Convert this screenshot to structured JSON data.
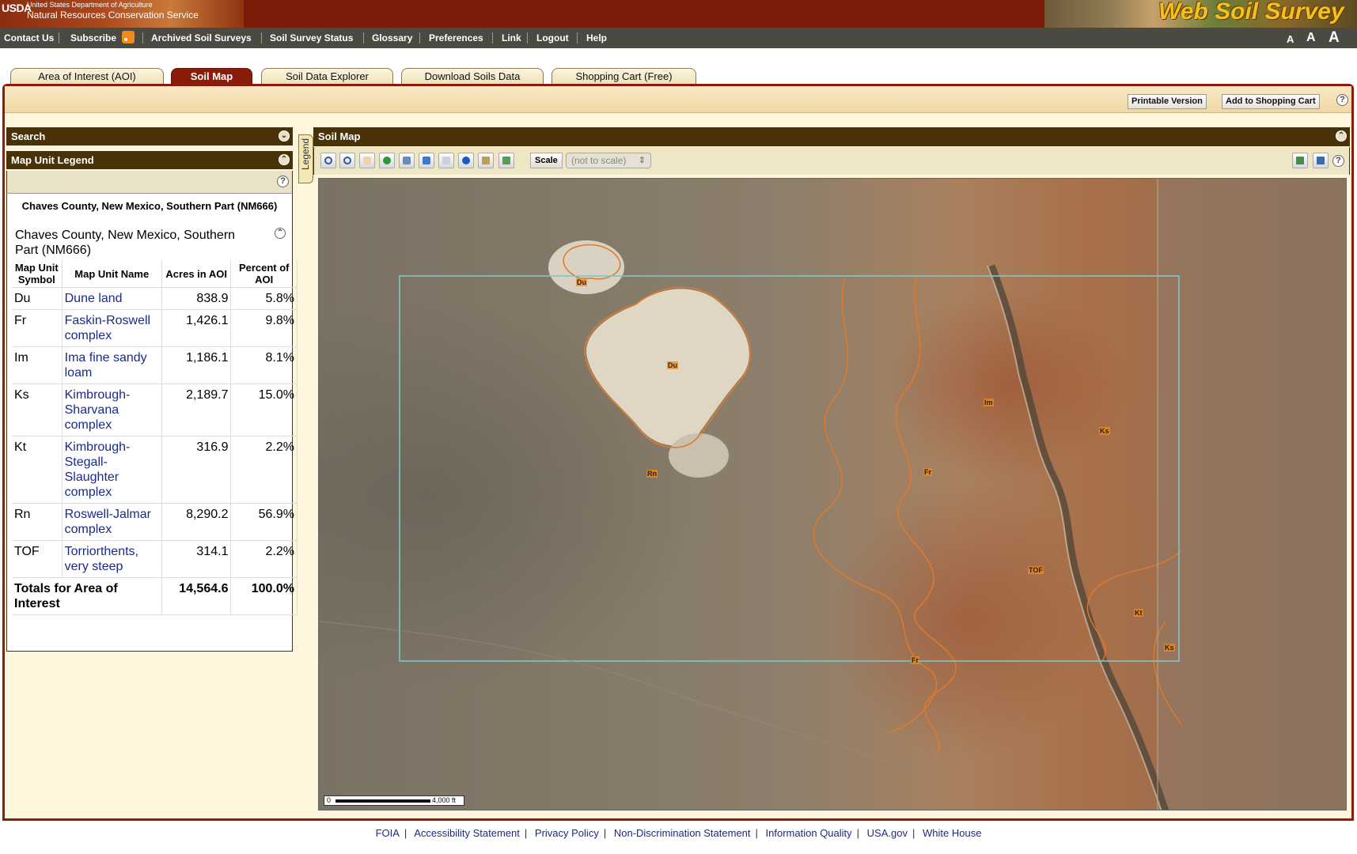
{
  "header": {
    "usda_mark": "USDA",
    "agency_line1": "United States Department of Agriculture",
    "agency_line2": "Natural Resources Conservation Service",
    "app_title": "Web Soil Survey"
  },
  "topnav": {
    "items": [
      "Contact Us",
      "Subscribe",
      "Archived Soil Surveys",
      "Soil Survey Status",
      "Glossary",
      "Preferences",
      "Link",
      "Logout",
      "Help"
    ],
    "font_sizes": [
      "A",
      "A",
      "A"
    ]
  },
  "tabs": [
    "Area of Interest (AOI)",
    "Soil Map",
    "Soil Data Explorer",
    "Download Soils Data",
    "Shopping Cart (Free)"
  ],
  "active_tab": "Soil Map",
  "actions": {
    "printable": "Printable Version",
    "add_cart": "Add to Shopping Cart",
    "help": "?"
  },
  "left_panel": {
    "search_title": "Search",
    "legend_title": "Map Unit Legend",
    "survey_heading": "Chaves County, New Mexico, Southern Part (NM666)",
    "survey_name": "Chaves County, New Mexico, Southern Part (NM666)",
    "columns": [
      "Map Unit Symbol",
      "Map Unit Name",
      "Acres in AOI",
      "Percent of AOI"
    ],
    "rows": [
      {
        "symbol": "Du",
        "name": "Dune land",
        "acres": "838.9",
        "percent": "5.8%"
      },
      {
        "symbol": "Fr",
        "name": "Faskin-Roswell complex",
        "acres": "1,426.1",
        "percent": "9.8%"
      },
      {
        "symbol": "Im",
        "name": "Ima fine sandy loam",
        "acres": "1,186.1",
        "percent": "8.1%"
      },
      {
        "symbol": "Ks",
        "name": "Kimbrough-Sharvana complex",
        "acres": "2,189.7",
        "percent": "15.0%"
      },
      {
        "symbol": "Kt",
        "name": "Kimbrough-Stegall-Slaughter complex",
        "acres": "316.9",
        "percent": "2.2%"
      },
      {
        "symbol": "Rn",
        "name": "Roswell-Jalmar complex",
        "acres": "8,290.2",
        "percent": "56.9%"
      },
      {
        "symbol": "TOF",
        "name": "Torriorthents, very steep",
        "acres": "314.1",
        "percent": "2.2%"
      }
    ],
    "total": {
      "label": "Totals for Area of Interest",
      "acres": "14,564.6",
      "percent": "100.0%"
    }
  },
  "legend_tab": "Legend",
  "map_panel": {
    "title": "Soil Map",
    "scale_label": "Scale",
    "scale_value": "(not to scale)",
    "tools": [
      "zoom-in",
      "zoom-out",
      "pan",
      "zoom-to-full",
      "zoom-to-aoi",
      "previous-view",
      "next-view",
      "identify",
      "measure",
      "clear"
    ],
    "map_labels": [
      "Du",
      "Du",
      "Rn",
      "Im",
      "Fr",
      "Ks",
      "TOF",
      "Kt",
      "Ks",
      "Fr"
    ],
    "scale_bar": {
      "start": "0",
      "end": "4,000 ft"
    }
  },
  "footer": [
    "FOIA",
    "Accessibility Statement",
    "Privacy Policy",
    "Non-Discrimination Statement",
    "Information Quality",
    "USA.gov",
    "White House"
  ],
  "colors": {
    "brand_dark_red": "#8a1c0a",
    "panel_header_brown": "#4a3208",
    "nav_gray": "#4a4a43",
    "panel_background": "#fdf6dc",
    "link_blue": "#1a2a8c",
    "soil_boundary_orange": "#e07a2a",
    "aoi_outline_cyan": "#7ac8c8"
  }
}
